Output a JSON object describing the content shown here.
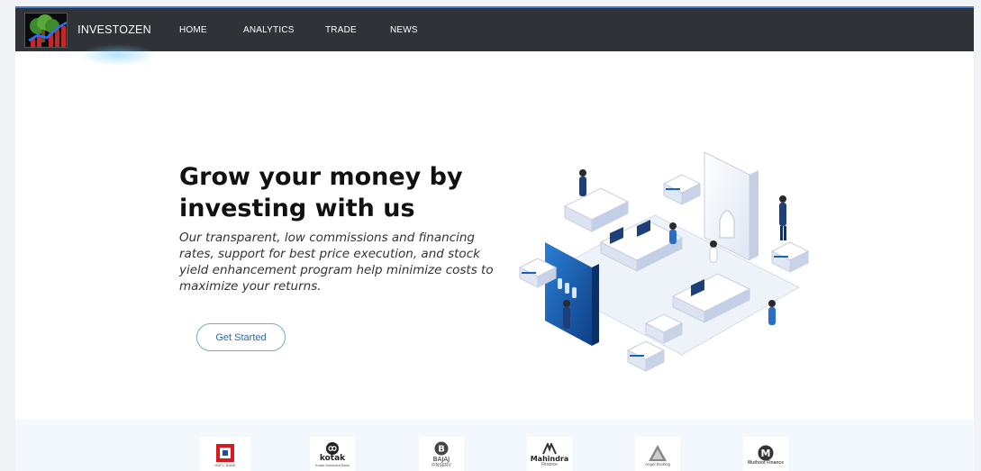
{
  "navbar": {
    "brand": "INVESTOZEN",
    "items": [
      {
        "label": "HOME"
      },
      {
        "label": "ANALYTICS"
      },
      {
        "label": "TRADE"
      },
      {
        "label": "NEWS"
      }
    ]
  },
  "hero": {
    "title": "Grow your money by investing with us",
    "description": "Our transparent, low commissions and financing rates, support for best price execution, and stock yield enhancement program help minimize costs to maximize your returns.",
    "cta_label": "Get Started"
  },
  "partners": [
    {
      "name": "",
      "sub": "HDFC BANK"
    },
    {
      "name": "kotak",
      "sub": "Kotak Mahindra Bank"
    },
    {
      "name": "BAJAJ",
      "sub": "FINSERV"
    },
    {
      "name": "Mahindra",
      "sub": "Finance"
    },
    {
      "name": "",
      "sub": "Angel Broking"
    },
    {
      "name": "",
      "sub": "Muthoot Finance"
    }
  ],
  "colors": {
    "navbar_bg": "#2f3337",
    "accent": "#2a6a9e",
    "partner_strip_bg": "#f3f8fc"
  }
}
